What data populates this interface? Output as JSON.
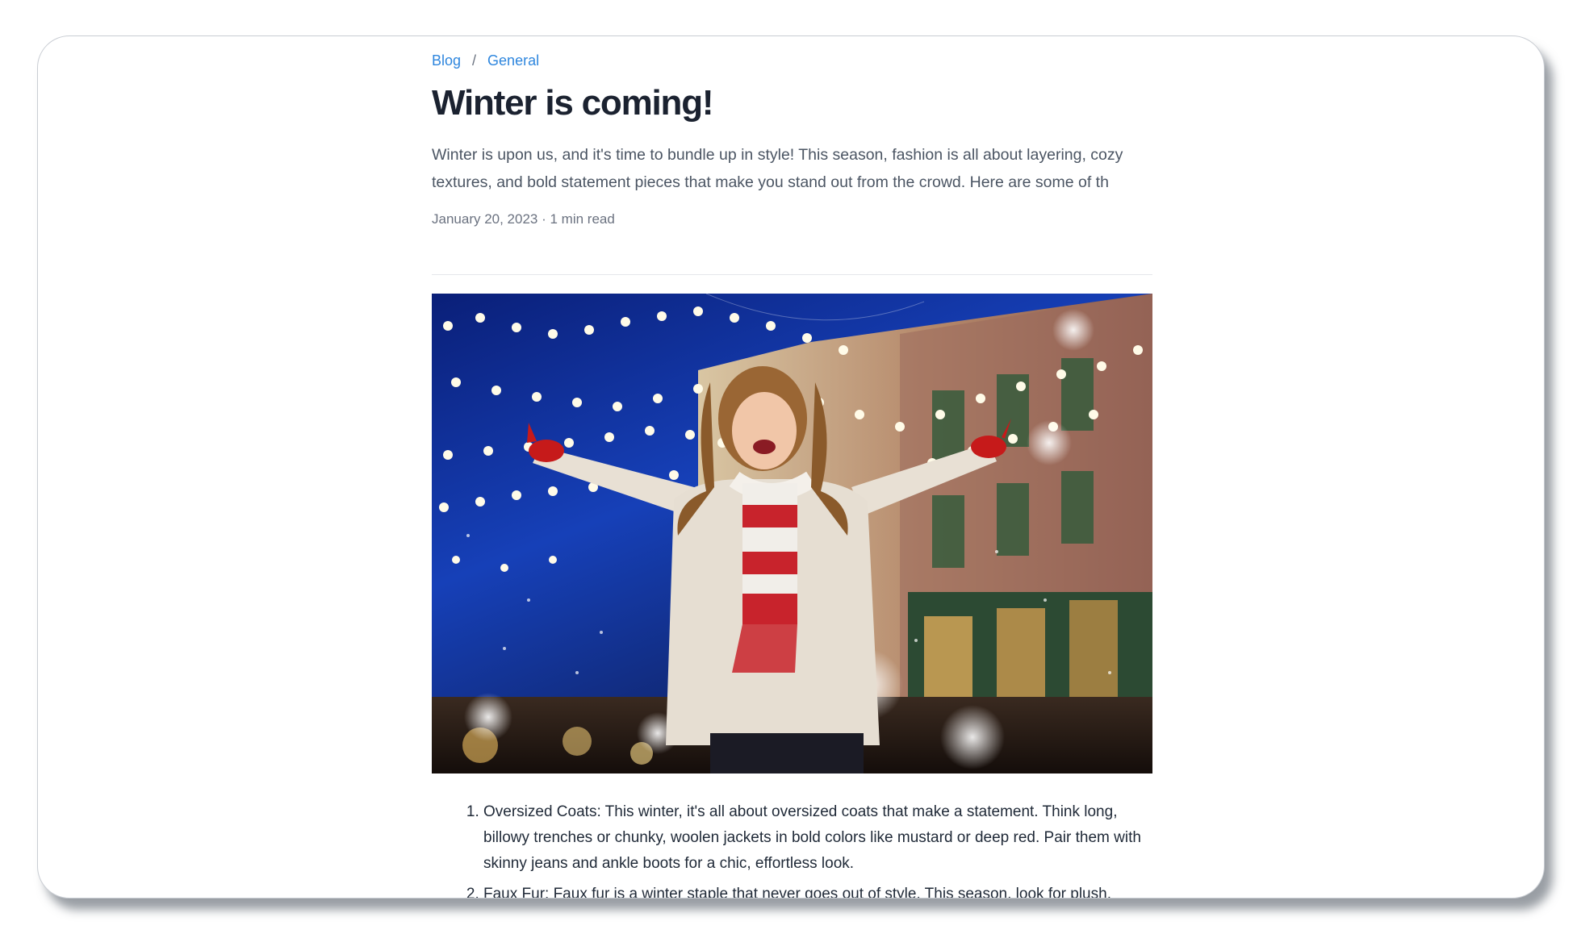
{
  "breadcrumb": {
    "items": [
      "Blog",
      "General"
    ],
    "separator": "/"
  },
  "post": {
    "title": "Winter is coming!",
    "excerpt": "Winter is upon us, and it's time to bundle up in style! This season, fashion is all about layering, cozy textures, and bold statement pieces that make you stand out from the crowd. Here are some of th",
    "meta": "January 20, 2023 · 1 min read",
    "image_alt": "Woman in white coat and red-white striped scarf with arms raised under string lights and falling snow",
    "list_items": [
      "Oversized Coats: This winter, it's all about oversized coats that make a statement. Think long, billowy trenches or chunky, woolen jackets in bold colors like mustard or deep red. Pair them with skinny jeans and ankle boots for a chic, effortless look.",
      "Faux Fur: Faux fur is a winter staple that never goes out of style. This season, look for plush,"
    ]
  },
  "colors": {
    "link": "#2e86de",
    "title": "#1b2230",
    "body_text": "#4b5563",
    "muted": "#6b7280",
    "divider": "#e5e7eb"
  },
  "icons": [
    "photo"
  ]
}
